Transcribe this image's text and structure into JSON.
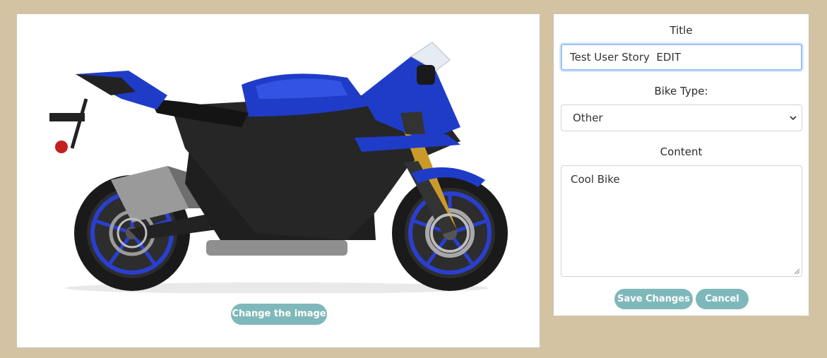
{
  "image_panel": {
    "image_alt": "Blue sport motorcycle",
    "change_image_label": "Change the image"
  },
  "form": {
    "title_label": "Title",
    "title_value": "Test User Story  EDIT",
    "bike_type_label": "Bike Type:",
    "bike_type_value": "Other",
    "content_label": "Content",
    "content_value": "Cool Bike",
    "save_label": "Save Changes",
    "cancel_label": "Cancel"
  },
  "colors": {
    "background": "#d3c3a2",
    "button": "#7fb8ba",
    "focus_border": "#9cc2f0",
    "bike_blue": "#1f3cc8"
  },
  "icons": {
    "select": "chevron-down-icon",
    "textarea": "resize-grip-icon"
  }
}
